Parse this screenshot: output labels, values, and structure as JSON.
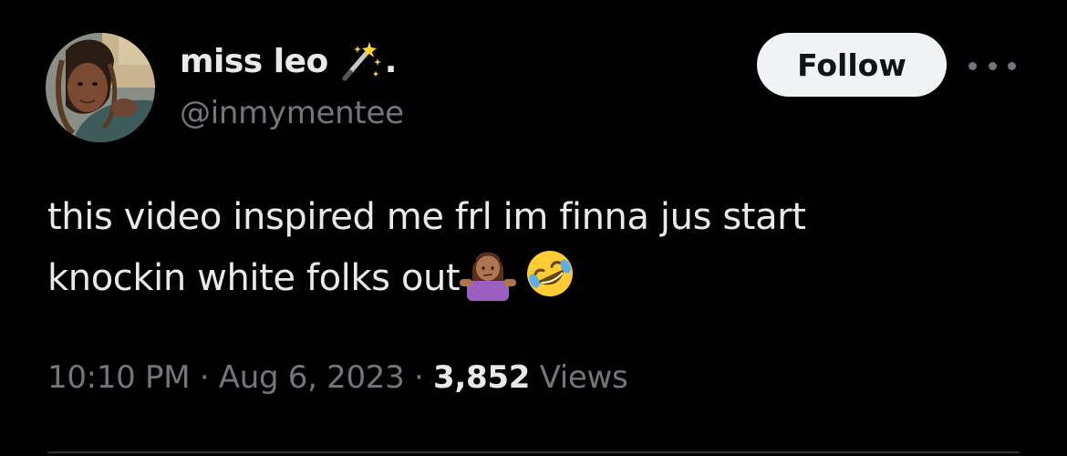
{
  "author": {
    "display_name": "miss leo",
    "name_suffix": ".",
    "name_emoji_icon": "magic-wand-icon",
    "handle": "@inmymentee",
    "avatar_icon": "profile-photo"
  },
  "actions": {
    "follow_label": "Follow",
    "more_icon": "more-horizontal-icon"
  },
  "tweet": {
    "line1": "this video inspired me frl im finna jus start",
    "line2": "knockin white folks out",
    "emojis": [
      "person-shrugging-emoji",
      "rolling-on-floor-laughing-emoji"
    ]
  },
  "meta": {
    "time": "10:10 PM",
    "separator": "·",
    "date": "Aug 6, 2023",
    "views_count": "3,852",
    "views_label": "Views"
  },
  "colors": {
    "background": "#000000",
    "text_primary": "#e7e9ea",
    "text_secondary": "#71767b",
    "follow_bg": "#eff3f4",
    "divider": "#2f3336"
  }
}
